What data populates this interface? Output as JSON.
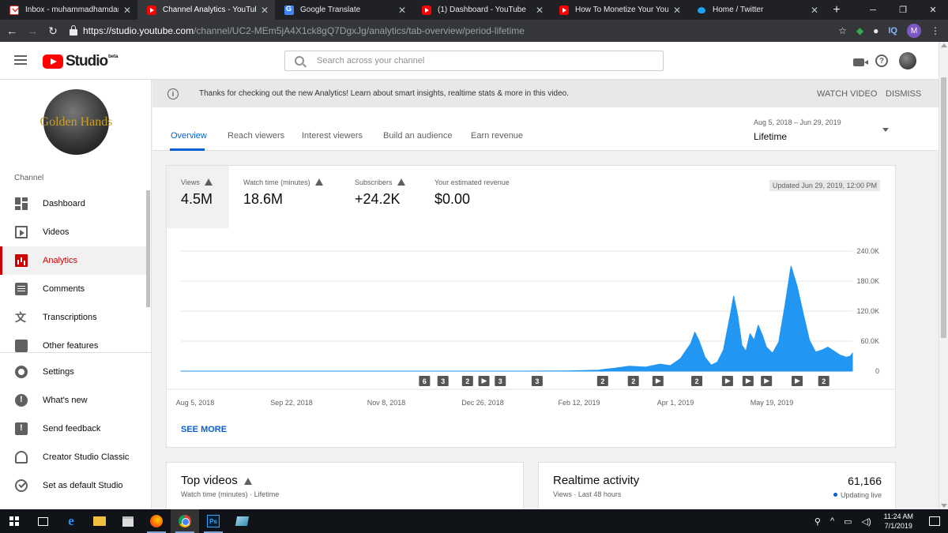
{
  "browser": {
    "tabs": [
      {
        "title": "Inbox - muhammadhamdanmalik@gmail.com",
        "icon": "gmail-icon",
        "active": false
      },
      {
        "title": "Channel Analytics - YouTube Studio",
        "icon": "youtube-icon",
        "active": true
      },
      {
        "title": "Google Translate",
        "icon": "google-translate-icon",
        "active": false
      },
      {
        "title": "(1) Dashboard - YouTube",
        "icon": "youtube-icon",
        "active": false
      },
      {
        "title": "How To Monetize Your YouTube",
        "icon": "youtube-icon",
        "active": false
      },
      {
        "title": "Home / Twitter",
        "icon": "twitter-icon",
        "active": false
      }
    ],
    "new_tab": "+",
    "window_controls": {
      "minimize": "─",
      "restore": "❐",
      "close": "✕"
    },
    "url_host": "https://studio.youtube.com",
    "url_path": "/channel/UC2-MEm5jA4X1ck8gQ7DgxJg/analytics/tab-overview/period-lifetime",
    "ext_label": "IQ",
    "profile_initial": "M"
  },
  "header": {
    "logo_text": "Studio",
    "logo_badge": "beta",
    "search_placeholder": "Search across your channel"
  },
  "sidebar": {
    "channel_avatar_text": "Golden Hands",
    "section_label": "Channel",
    "items": [
      {
        "label": "Dashboard",
        "icon": "dashboard-icon",
        "active": false
      },
      {
        "label": "Videos",
        "icon": "videos-icon",
        "active": false
      },
      {
        "label": "Analytics",
        "icon": "analytics-icon",
        "active": true
      },
      {
        "label": "Comments",
        "icon": "comments-icon",
        "active": false
      },
      {
        "label": "Transcriptions",
        "icon": "transcriptions-icon",
        "active": false
      },
      {
        "label": "Other features",
        "icon": "other-features-icon",
        "active": false
      }
    ],
    "bottom_items": [
      {
        "label": "Settings",
        "icon": "settings-icon"
      },
      {
        "label": "What's new",
        "icon": "whats-new-icon"
      },
      {
        "label": "Send feedback",
        "icon": "feedback-icon"
      },
      {
        "label": "Creator Studio Classic",
        "icon": "classic-studio-icon"
      },
      {
        "label": "Set as default Studio",
        "icon": "check-circle-icon"
      }
    ]
  },
  "notice": {
    "message": "Thanks for checking out the new Analytics! Learn about smart insights, realtime stats & more in this video.",
    "watch_video": "WATCH VIDEO",
    "dismiss": "DISMISS"
  },
  "tabs": {
    "items": [
      "Overview",
      "Reach viewers",
      "Interest viewers",
      "Build an audience",
      "Earn revenue"
    ],
    "active": "Overview",
    "date_range": "Aug 5, 2018 – Jun 29, 2019",
    "period": "Lifetime"
  },
  "metrics": [
    {
      "label": "Views",
      "value": "4.5M",
      "warning": true,
      "selected": true
    },
    {
      "label": "Watch time (minutes)",
      "value": "18.6M",
      "warning": true,
      "selected": false
    },
    {
      "label": "Subscribers",
      "value": "+24.2K",
      "warning": true,
      "selected": false
    },
    {
      "label": "Your estimated revenue",
      "value": "$0.00",
      "warning": false,
      "selected": false
    }
  ],
  "updated": "Updated Jun 29, 2019, 12:00 PM",
  "see_more": "SEE MORE",
  "chart_data": {
    "type": "area",
    "x_labels": [
      "Aug 5, 2018",
      "Sep 22, 2018",
      "Nov 8, 2018",
      "Dec 26, 2018",
      "Feb 12, 2019",
      "Apr 1, 2019",
      "May 19, 2019"
    ],
    "y_ticks": [
      "240.0K",
      "180.0K",
      "120.0K",
      "60.0K",
      "0"
    ],
    "ylim": [
      0,
      240000
    ],
    "grid": true,
    "color": "#2196f3",
    "series": [
      {
        "points": [
          [
            "2018-08-05",
            0
          ],
          [
            "2019-01-15",
            0
          ],
          [
            "2019-02-10",
            500
          ],
          [
            "2019-02-25",
            2000
          ],
          [
            "2019-03-05",
            6000
          ],
          [
            "2019-03-12",
            10000
          ],
          [
            "2019-03-20",
            8000
          ],
          [
            "2019-03-27",
            14000
          ],
          [
            "2019-04-01",
            11000
          ],
          [
            "2019-04-06",
            25000
          ],
          [
            "2019-04-11",
            55000
          ],
          [
            "2019-04-13",
            78000
          ],
          [
            "2019-04-15",
            62000
          ],
          [
            "2019-04-18",
            28000
          ],
          [
            "2019-04-21",
            12000
          ],
          [
            "2019-04-24",
            18000
          ],
          [
            "2019-04-27",
            42000
          ],
          [
            "2019-04-30",
            105000
          ],
          [
            "2019-05-02",
            150000
          ],
          [
            "2019-05-04",
            110000
          ],
          [
            "2019-05-06",
            52000
          ],
          [
            "2019-05-08",
            40000
          ],
          [
            "2019-05-10",
            75000
          ],
          [
            "2019-05-12",
            62000
          ],
          [
            "2019-05-14",
            92000
          ],
          [
            "2019-05-16",
            72000
          ],
          [
            "2019-05-18",
            48000
          ],
          [
            "2019-05-21",
            36000
          ],
          [
            "2019-05-24",
            58000
          ],
          [
            "2019-05-27",
            130000
          ],
          [
            "2019-05-30",
            210000
          ],
          [
            "2019-06-02",
            170000
          ],
          [
            "2019-06-05",
            115000
          ],
          [
            "2019-06-08",
            62000
          ],
          [
            "2019-06-11",
            38000
          ],
          [
            "2019-06-14",
            42000
          ],
          [
            "2019-06-17",
            48000
          ],
          [
            "2019-06-20",
            40000
          ],
          [
            "2019-06-23",
            32000
          ],
          [
            "2019-06-26",
            28000
          ],
          [
            "2019-06-28",
            30000
          ],
          [
            "2019-06-29",
            36000
          ]
        ]
      }
    ],
    "event_markers": [
      {
        "date": "2018-12-02",
        "label": "6"
      },
      {
        "date": "2018-12-11",
        "label": "3"
      },
      {
        "date": "2018-12-23",
        "label": "2"
      },
      {
        "date": "2018-12-31",
        "label": "play"
      },
      {
        "date": "2019-01-08",
        "label": "3"
      },
      {
        "date": "2019-01-26",
        "label": "3"
      },
      {
        "date": "2019-02-27",
        "label": "2"
      },
      {
        "date": "2019-03-14",
        "label": "2"
      },
      {
        "date": "2019-03-26",
        "label": "play"
      },
      {
        "date": "2019-04-14",
        "label": "2"
      },
      {
        "date": "2019-04-29",
        "label": "play"
      },
      {
        "date": "2019-05-09",
        "label": "play"
      },
      {
        "date": "2019-05-18",
        "label": "play"
      },
      {
        "date": "2019-06-02",
        "label": "play"
      },
      {
        "date": "2019-06-15",
        "label": "2"
      }
    ]
  },
  "top_videos": {
    "title": "Top videos",
    "subtitle": "Watch time (minutes) · Lifetime"
  },
  "realtime": {
    "title": "Realtime activity",
    "subtitle": "Views · Last 48 hours",
    "count": "61,166",
    "status": "Updating live"
  },
  "taskbar": {
    "time": "11:24 AM",
    "date": "7/1/2019",
    "apps": [
      "start-icon",
      "task-view-icon",
      "edge-icon",
      "file-explorer-icon",
      "store-icon",
      "firefox-icon",
      "chrome-icon",
      "photoshop-icon",
      "app-icon"
    ]
  }
}
